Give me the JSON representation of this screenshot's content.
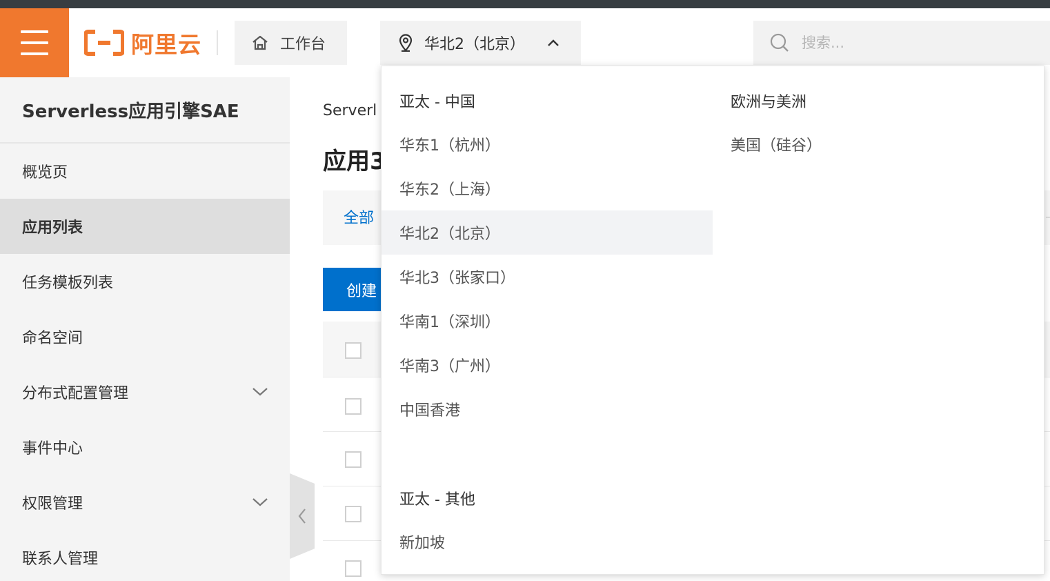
{
  "header": {
    "logo_text": "阿里云",
    "workbench_label": "工作台",
    "region_label": "华北2（北京）",
    "search_placeholder": "搜索..."
  },
  "sidebar": {
    "title": "Serverless应用引擎SAE",
    "items": [
      {
        "label": "概览页"
      },
      {
        "label": "应用列表"
      },
      {
        "label": "任务模板列表"
      },
      {
        "label": "命名空间"
      },
      {
        "label": "分布式配置管理"
      },
      {
        "label": "事件中心"
      },
      {
        "label": "权限管理"
      },
      {
        "label": "联系人管理"
      }
    ]
  },
  "main": {
    "breadcrumb": "Serverl",
    "page_title": "应用3",
    "tab_all": "全部",
    "create_button": "创建"
  },
  "region_dropdown": {
    "groups": [
      {
        "title": "亚太 - 中国",
        "items": [
          "华东1（杭州）",
          "华东2（上海）",
          "华北2（北京）",
          "华北3（张家口）",
          "华南1（深圳）",
          "华南3（广州）",
          "中国香港"
        ]
      },
      {
        "title": "欧洲与美洲",
        "items": [
          "美国（硅谷）"
        ]
      },
      {
        "title": "亚太 - 其他",
        "items": [
          "新加坡"
        ]
      }
    ],
    "selected": "华北2（北京）"
  },
  "colors": {
    "brand_orange": "#f0782e",
    "primary_blue": "#0070cc",
    "topstrip": "#373d41"
  }
}
